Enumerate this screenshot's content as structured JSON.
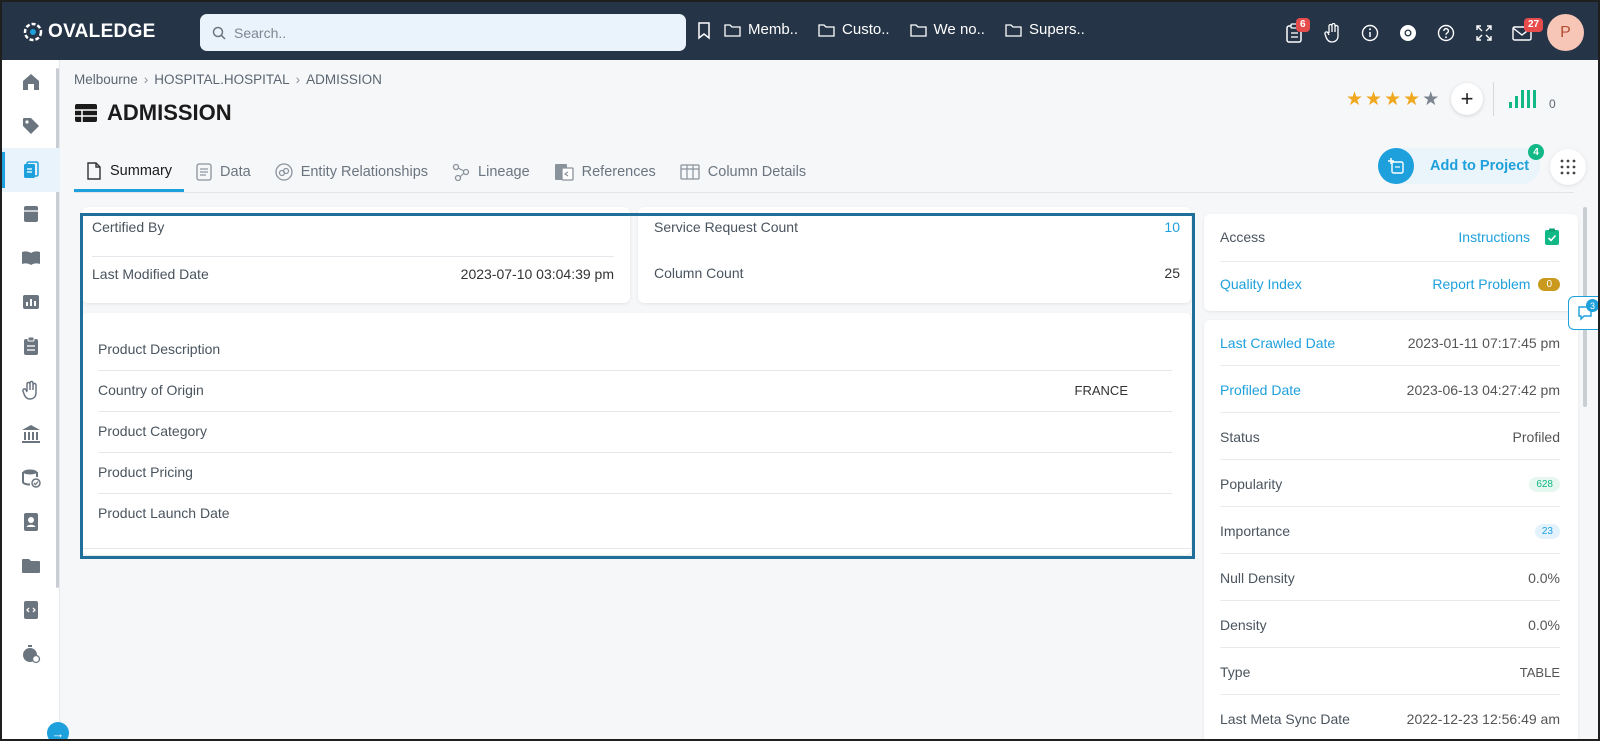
{
  "app": {
    "brand": "OVALEDGE"
  },
  "search": {
    "placeholder": "Search.."
  },
  "bookmarks": [
    "Memb..",
    "Custo..",
    "We no..",
    "Supers.."
  ],
  "topbar": {
    "tasks_badge": "6",
    "mail_badge": "27",
    "avatar_initial": "P"
  },
  "breadcrumb": [
    "Melbourne",
    "HOSPITAL.HOSPITAL",
    "ADMISSION"
  ],
  "page": {
    "title": "ADMISSION",
    "rating": 4,
    "rating_max": 5,
    "bars_count": "0"
  },
  "tabs": [
    "Summary",
    "Data",
    "Entity Relationships",
    "Lineage",
    "References",
    "Column Details"
  ],
  "actions": {
    "add_to_project": "Add to Project",
    "project_badge": "4"
  },
  "summary": {
    "left_card": [
      {
        "label": "Certified By",
        "value": ""
      },
      {
        "label": "Last Modified Date",
        "value": "2023-07-10 03:04:39 pm"
      }
    ],
    "right_card": [
      {
        "label": "Service Request Count",
        "value": "10"
      },
      {
        "label": "Column Count",
        "value": "25"
      }
    ],
    "custom_fields": [
      {
        "label": "Product Description",
        "value": ""
      },
      {
        "label": "Country of Origin",
        "value": "FRANCE"
      },
      {
        "label": "Product Category",
        "value": ""
      },
      {
        "label": "Product Pricing",
        "value": ""
      },
      {
        "label": "Product Launch Date",
        "value": ""
      }
    ]
  },
  "right_panel": {
    "access": {
      "label": "Access",
      "value": "Instructions"
    },
    "quality": {
      "label": "Quality Index",
      "value": "Report Problem",
      "count": "0"
    },
    "details": [
      {
        "label": "Last Crawled Date",
        "value": "2023-01-11 07:17:45 pm"
      },
      {
        "label": "Profiled Date",
        "value": "2023-06-13 04:27:42 pm"
      },
      {
        "label": "Status",
        "value": "Profiled"
      },
      {
        "label": "Popularity",
        "value": "628"
      },
      {
        "label": "Importance",
        "value": "23"
      },
      {
        "label": "Null Density",
        "value": "0.0%"
      },
      {
        "label": "Density",
        "value": "0.0%"
      },
      {
        "label": "Type",
        "value": "TABLE"
      },
      {
        "label": "Last Meta Sync Date",
        "value": "2022-12-23 12:56:49 am"
      }
    ],
    "chat_badge": "3"
  },
  "colors": {
    "topbar": "#253447",
    "accent": "#1ea0dc",
    "highlight": "#1f6f9a",
    "star": "#f0a820",
    "green": "#12b886"
  }
}
